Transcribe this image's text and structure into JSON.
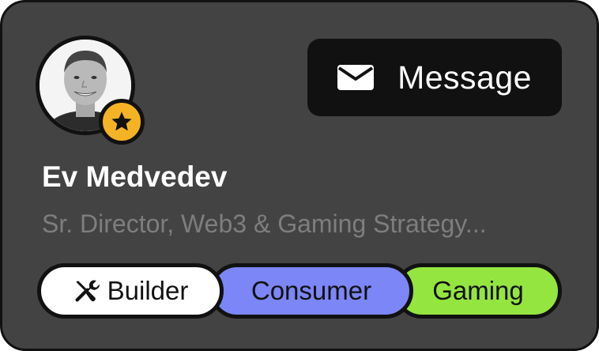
{
  "profile": {
    "name": "Ev Medvedev",
    "title": "Sr. Director, Web3 & Gaming Strategy..."
  },
  "actions": {
    "message_label": "Message"
  },
  "tags": [
    {
      "label": "Builder",
      "icon": "tools-icon",
      "color": "#ffffff"
    },
    {
      "label": "Consumer",
      "color": "#7c86f6"
    },
    {
      "label": "Gaming",
      "color": "#94e540"
    }
  ],
  "colors": {
    "card_background": "#434343",
    "badge": "#f4b324",
    "button_background": "#111111"
  },
  "icons": {
    "avatar_badge": "star-icon",
    "message": "envelope-icon"
  }
}
